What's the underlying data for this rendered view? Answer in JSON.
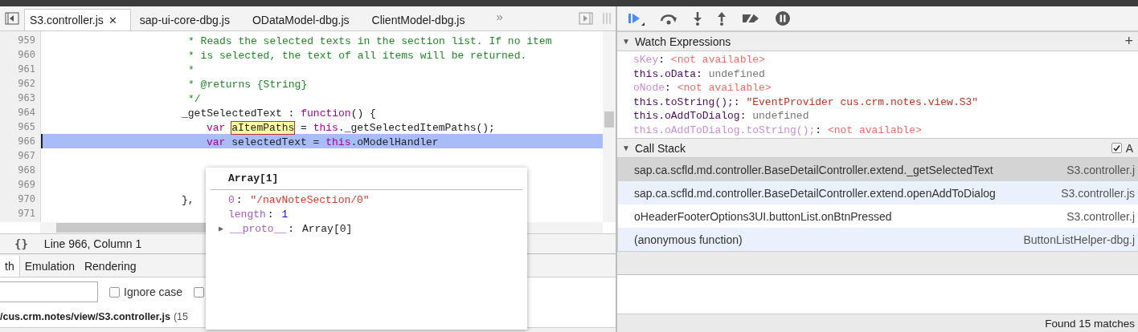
{
  "editor": {
    "tabs": [
      {
        "label": "S3.controller.js",
        "selected": true,
        "close": "✕"
      },
      {
        "label": "sap-ui-core-dbg.js",
        "selected": false
      },
      {
        "label": "ODataModel-dbg.js",
        "selected": false
      },
      {
        "label": "ClientModel-dbg.js",
        "selected": false
      }
    ],
    "overflow": "»",
    "lines": [
      {
        "n": "959",
        "selected": false,
        "kind": "comment",
        "tokens": [
          {
            "t": "* Reads the selected texts in the section list. If no item",
            "kind": "comment"
          }
        ]
      },
      {
        "n": "960",
        "selected": false,
        "kind": "comment",
        "tokens": [
          {
            "t": "* is selected, the text of all items will be returned.",
            "kind": "comment"
          }
        ]
      },
      {
        "n": "961",
        "selected": false,
        "kind": "comment",
        "tokens": [
          {
            "t": "*",
            "kind": "comment"
          }
        ]
      },
      {
        "n": "962",
        "selected": false,
        "kind": "comment",
        "tokens": [
          {
            "t": "* @returns {String}",
            "kind": "comment"
          }
        ]
      },
      {
        "n": "963",
        "selected": false,
        "kind": "comment",
        "tokens": [
          {
            "t": "*/",
            "kind": "comment"
          }
        ]
      },
      {
        "n": "964",
        "selected": false,
        "kind": "member",
        "tokens": [
          {
            "t": "_getSelectedText : ",
            "kind": "plain"
          },
          {
            "t": "function",
            "kind": "keyword"
          },
          {
            "t": "() {",
            "kind": "plain"
          }
        ]
      },
      {
        "n": "965",
        "selected": false,
        "kind": "body",
        "tokens": [
          {
            "t": "var ",
            "kind": "keyword"
          },
          {
            "t": "aItemPaths",
            "kind": "highlight"
          },
          {
            "t": " = ",
            "kind": "plain"
          },
          {
            "t": "this",
            "kind": "keyword"
          },
          {
            "t": "._getSelectedItemPaths();",
            "kind": "plain"
          }
        ]
      },
      {
        "n": "966",
        "selected": true,
        "kind": "body",
        "tokens": [
          {
            "t": "var",
            "kind": "keyword"
          },
          {
            "t": " selectedText = ",
            "kind": "plain"
          },
          {
            "t": "this",
            "kind": "keyword"
          },
          {
            "t": ".oModelHandler",
            "kind": "plain"
          }
        ]
      },
      {
        "n": "967",
        "selected": false
      },
      {
        "n": "968",
        "selected": false
      },
      {
        "n": "969",
        "selected": false
      },
      {
        "n": "970",
        "selected": false,
        "kind": "member",
        "tokens": [
          {
            "t": "},",
            "kind": "plain"
          }
        ]
      },
      {
        "n": "971",
        "selected": false
      }
    ],
    "status": {
      "format_button": "{}",
      "position": "Line 966, Column 1"
    }
  },
  "popover": {
    "title": "Array[1]",
    "rows": [
      {
        "key": "0",
        "separator": ":",
        "value": "\"/navNoteSection/0\"",
        "kind": "string"
      },
      {
        "key": "length",
        "separator": ":",
        "value": "1",
        "kind": "number"
      },
      {
        "toggle": "▶",
        "key": "__proto__",
        "separator": ":",
        "value": "Array[0]",
        "kind": "object"
      }
    ]
  },
  "drawer": {
    "tabs": [
      {
        "label": "th",
        "selected": true
      },
      {
        "label": "Emulation",
        "selected": false
      },
      {
        "label": "Rendering",
        "selected": false
      }
    ],
    "search": {
      "options": [
        {
          "label": "Ignore case",
          "checked": false
        },
        {
          "checked": false
        }
      ]
    },
    "result": {
      "path": "/cus.crm.notes/view/S3.controller.js",
      "count": "(15"
    }
  },
  "debugger": {
    "watch": {
      "title": "Watch Expressions",
      "toggle": "▼",
      "add": "+",
      "items": [
        {
          "name": "sKey",
          "separator": ":",
          "value": "<not available>",
          "available": false,
          "kind": "na"
        },
        {
          "name": "this.oData",
          "separator": ":",
          "value": "undefined",
          "available": true,
          "kind": "undefined"
        },
        {
          "name": "oNode",
          "separator": ":",
          "value": "<not available>",
          "available": false,
          "kind": "na"
        },
        {
          "name": "this.toString();",
          "separator": ":",
          "value": "\"EventProvider cus.crm.notes.view.S3\"",
          "available": true,
          "kind": "string"
        },
        {
          "name": "this.oAddToDialog",
          "separator": ":",
          "value": "undefined",
          "available": true,
          "kind": "undefined"
        },
        {
          "name": "this.oAddToDialog.toString();",
          "separator": ":",
          "value": "<not available>",
          "available": false,
          "kind": "na"
        }
      ]
    },
    "call_stack": {
      "title": "Call Stack",
      "toggle": "▼",
      "async": {
        "label": "A",
        "checked": true
      },
      "frames": [
        {
          "function": "sap.ca.scfld.md.controller.BaseDetailController.extend._getSelectedText",
          "file": "S3.controller.j",
          "selected": true
        },
        {
          "function": "sap.ca.scfld.md.controller.BaseDetailController.extend.openAddToDialog",
          "file": "S3.controller.js",
          "selected": false
        },
        {
          "function": "oHeaderFooterOptions3UI.buttonList.onBtnPressed",
          "file": "S3.controller.j",
          "selected": false
        },
        {
          "function": "(anonymous function)",
          "file": "ButtonListHelper-dbg.j",
          "selected": false
        }
      ]
    },
    "footer": "Found 15 matches"
  }
}
